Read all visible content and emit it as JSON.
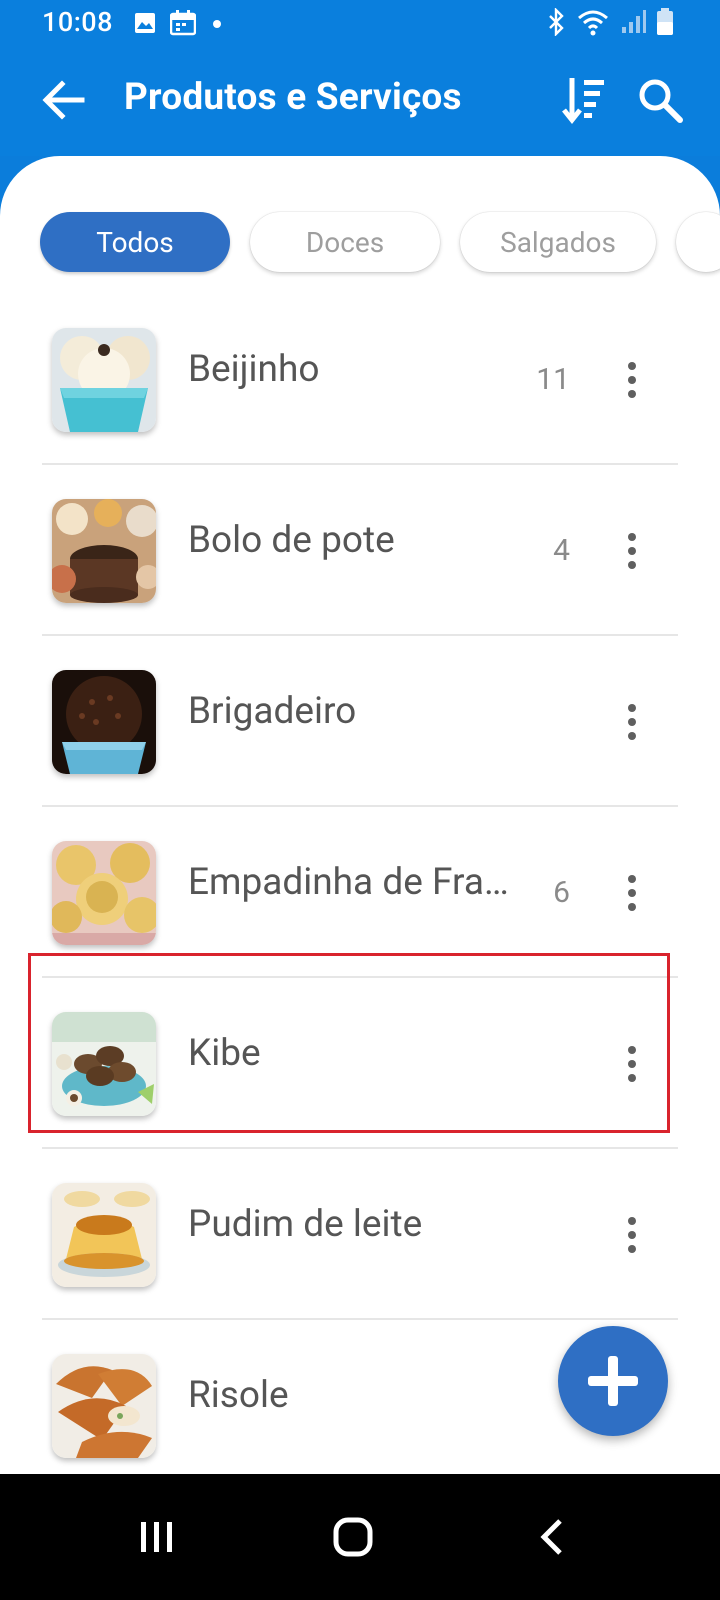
{
  "status_bar": {
    "time": "10:08",
    "left_icons": [
      "image-icon",
      "calendar-icon",
      "dot-icon"
    ],
    "right_icons": [
      "bluetooth-icon",
      "wifi-icon",
      "signal-icon",
      "battery-icon"
    ]
  },
  "app_bar": {
    "title": "Produtos e Serviços",
    "back_icon": "arrow-left-icon",
    "sort_icon": "sort-icon",
    "search_icon": "search-icon"
  },
  "filters": {
    "chips": [
      {
        "label": "Todos",
        "active": true
      },
      {
        "label": "Doces",
        "active": false
      },
      {
        "label": "Salgados",
        "active": false
      },
      {
        "label": "",
        "active": false
      }
    ]
  },
  "products": [
    {
      "name": "Beijinho",
      "count": "11"
    },
    {
      "name": "Bolo de pote",
      "count": "4"
    },
    {
      "name": "Brigadeiro",
      "count": ""
    },
    {
      "name": "Empadinha de Frango",
      "count": "6"
    },
    {
      "name": "Kibe",
      "count": ""
    },
    {
      "name": "Pudim de leite",
      "count": ""
    },
    {
      "name": "Risole",
      "count": ""
    }
  ],
  "fab": {
    "icon": "plus-icon"
  },
  "nav_bar": {
    "icons": [
      "recent-apps-icon",
      "home-icon",
      "back-icon"
    ]
  },
  "colors": {
    "primary": "#0a7fdd",
    "accent": "#2f6fc4",
    "highlight": "#d9232d"
  }
}
